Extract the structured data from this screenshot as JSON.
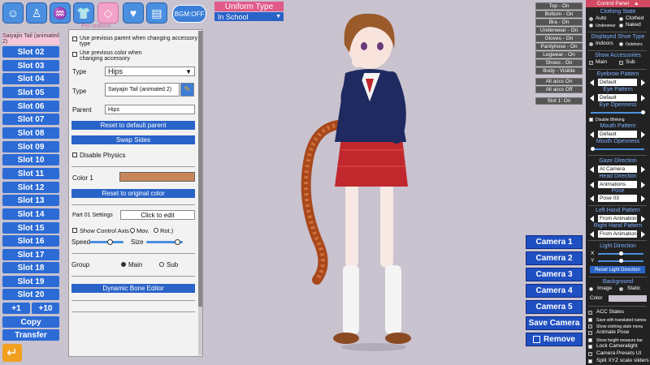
{
  "top_icons": {
    "icons": [
      "face-icon",
      "body-icon",
      "hair-icon",
      "clothing-icon",
      "accessory-icon",
      "heart-icon",
      "document-icon"
    ],
    "active_label": "Per uniform",
    "bgm_label": "BGM:OFF"
  },
  "slots": {
    "selected": "Saiyajin Tail (animated 2)",
    "items": [
      "Slot 02",
      "Slot 03",
      "Slot 04",
      "Slot 05",
      "Slot 06",
      "Slot 07",
      "Slot 08",
      "Slot 09",
      "Slot 10",
      "Slot 11",
      "Slot 12",
      "Slot 13",
      "Slot 14",
      "Slot 15",
      "Slot 16",
      "Slot 17",
      "Slot 18",
      "Slot 19",
      "Slot 20"
    ],
    "plus1": "+1",
    "plus10": "+10",
    "copy": "Copy",
    "transfer": "Transfer"
  },
  "accessory_panel": {
    "use_prev_parent": "Use previous parent when changing accessory type",
    "use_prev_color": "Use previous color when changing accessory",
    "type_label": "Type",
    "type_value": "Hips",
    "type2_label": "Type",
    "type2_value": "Saiyajin Tail (animated 2)",
    "parent_label": "Parent",
    "parent_value": "Hips",
    "reset_parent": "Reset to default parent",
    "swap_sides": "Swap Sides",
    "disable_physics": "Disable Physics",
    "color1_label": "Color 1",
    "color1_value": "#c8855a",
    "reset_color": "Reset to original color",
    "part_settings": "Part 01 Settings",
    "click_to_edit": "Click to edit",
    "show_control_axis": "Show Control Axis (",
    "mov": "Mov.",
    "rot": "Rot.)",
    "speed_label": "Speed",
    "size_label": "Size",
    "group_label": "Group",
    "group_main": "Main",
    "group_sub": "Sub",
    "dynamic_bone": "Dynamic Bone Editor"
  },
  "uniform": {
    "title": "Uniform Type",
    "value": "In School"
  },
  "right_toggles": [
    "Top - On",
    "Bottom - On",
    "Bra - On",
    "Underwear - On",
    "Gloves - On",
    "Pantyhose - On",
    "Legwear - On",
    "Shoes - On",
    "Body - Visible"
  ],
  "accs_toggles": [
    "All accs On",
    "All accs Off"
  ],
  "slot1_toggle": "Slot 1: On",
  "cameras": [
    "Camera 1",
    "Camera 2",
    "Camera 3",
    "Camera 4",
    "Camera 5"
  ],
  "save_camera": "Save Camera",
  "remove": "Remove",
  "control_panel": {
    "title": "Control Panel",
    "clothing_state": "Clothing State",
    "auto": "Auto",
    "clothed": "Clothed",
    "underwear": "Underwear",
    "naked": "Naked",
    "shoe_type": "Displayed Shoe Type",
    "indoors": "Indoors",
    "outdoors": "Outdoors",
    "show_accessories": "Show Accessories",
    "main": "Main",
    "sub": "Sub",
    "eyebrow_pattern": "Eyebrow Pattern",
    "eyebrow_value": "Default",
    "eye_pattern": "Eye Pattern",
    "eye_value": "Default",
    "eye_openness": "Eye Openness",
    "disable_blinking": "Disable Blinking",
    "mouth_pattern": "Mouth Pattern",
    "mouth_value": "Default",
    "mouth_openness": "Mouth Openness",
    "gaze_direction": "Gaze Direction",
    "gaze_value": "At Camera",
    "head_direction": "Head Direction",
    "head_value": "Animations",
    "pose": "Pose",
    "pose_value": "Pose 03",
    "left_hand": "Left Hand Pattern",
    "left_hand_value": "From Animation",
    "right_hand": "Right Hand Pattern",
    "right_hand_value": "From Animation",
    "light_direction": "Light Direction",
    "x_label": "X",
    "y_label": "Y",
    "reset_light": "Reset Light Direction",
    "background": "Background",
    "image": "Image",
    "static": "Static",
    "color": "Color",
    "acc_states": "ACC States",
    "save_translated": "Save with translated names",
    "show_clothing_menu": "Show clothing state menu",
    "animate_pose": "Animate Pose",
    "show_height_bar": "Show height measure bar",
    "lock_cameralight": "Lock Cameralight",
    "camera_presets": "Camera Presets UI",
    "split_xyz": "Split XYZ scale sliders"
  }
}
